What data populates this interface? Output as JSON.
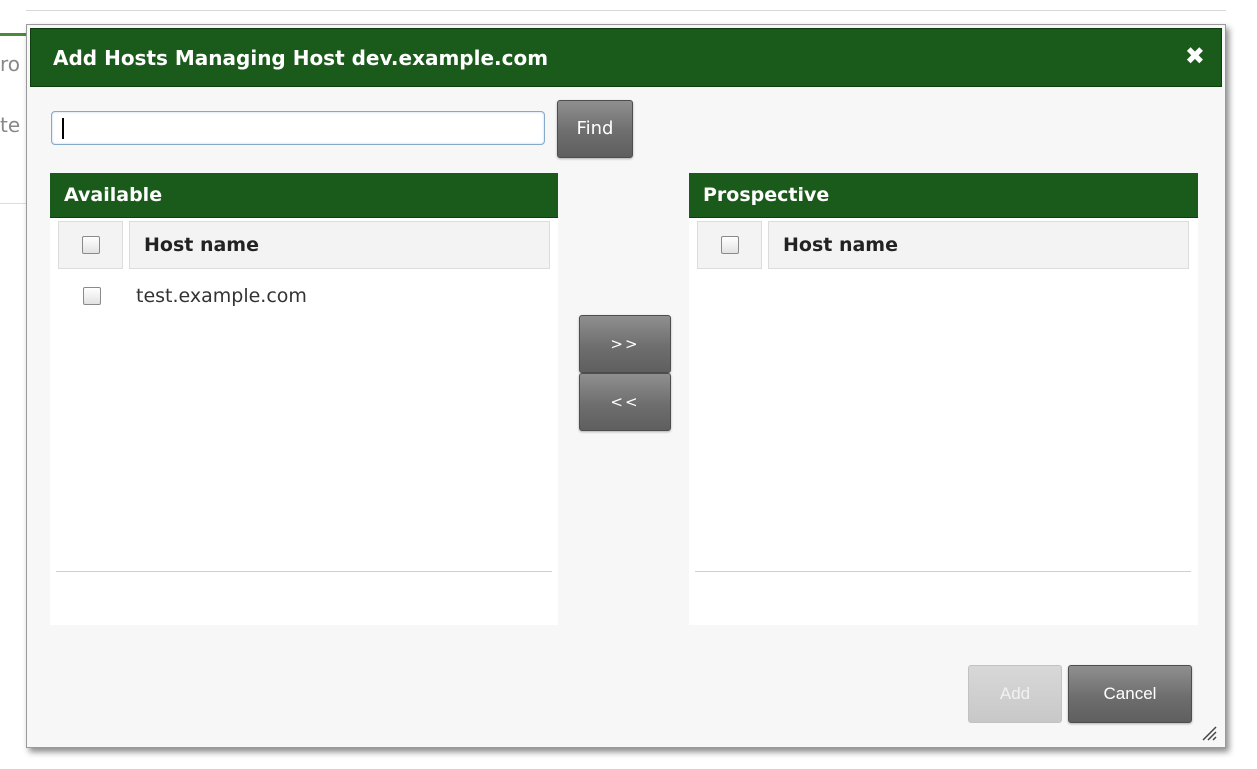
{
  "dialog": {
    "title": "Add Hosts Managing Host dev.example.com",
    "close_icon": "close-icon"
  },
  "search": {
    "value": "",
    "find_label": "Find"
  },
  "available": {
    "header": "Available",
    "column": "Host name",
    "rows": [
      {
        "host": "test.example.com",
        "checked": false
      }
    ]
  },
  "prospective": {
    "header": "Prospective",
    "column": "Host name",
    "rows": []
  },
  "transfer": {
    "add_label": ">>",
    "remove_label": "<<"
  },
  "footer": {
    "add_label": "Add",
    "cancel_label": "Cancel"
  },
  "background": {
    "fragment_1": "ro",
    "fragment_2": "te"
  },
  "colors": {
    "header_green": "#1a5a1a",
    "button_gray": "#6e6e6e",
    "disabled_gray": "#cccccc"
  }
}
